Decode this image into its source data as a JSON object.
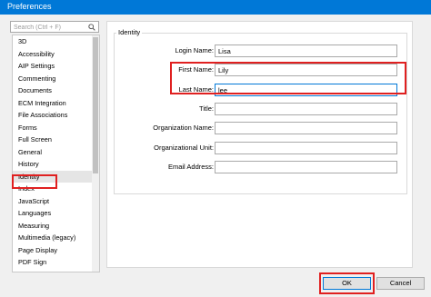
{
  "window": {
    "title": "Preferences"
  },
  "search": {
    "placeholder": "Search (Ctrl + F)",
    "icon": "search-icon"
  },
  "categories": {
    "items": [
      "3D",
      "Accessibility",
      "AIP Settings",
      "Commenting",
      "Documents",
      "ECM Integration",
      "File Associations",
      "Forms",
      "Full Screen",
      "General",
      "History",
      "Identity",
      "Index",
      "JavaScript",
      "Languages",
      "Measuring",
      "Multimedia (legacy)",
      "Page Display",
      "PDF Sign"
    ],
    "selected": "Identity"
  },
  "identity": {
    "group_title": "Identity",
    "fields": [
      {
        "label": "Login Name:",
        "value": "Lisa"
      },
      {
        "label": "First Name:",
        "value": "Lily"
      },
      {
        "label": "Last Name:",
        "value": "lee"
      },
      {
        "label": "Title:",
        "value": ""
      },
      {
        "label": "Organization Name:",
        "value": ""
      },
      {
        "label": "Organizational Unit:",
        "value": ""
      },
      {
        "label": "Email Address:",
        "value": ""
      }
    ]
  },
  "buttons": {
    "ok": "OK",
    "cancel": "Cancel"
  },
  "colors": {
    "titlebar": "#0078d7",
    "highlight": "#e02020",
    "focus": "#0078d7"
  }
}
